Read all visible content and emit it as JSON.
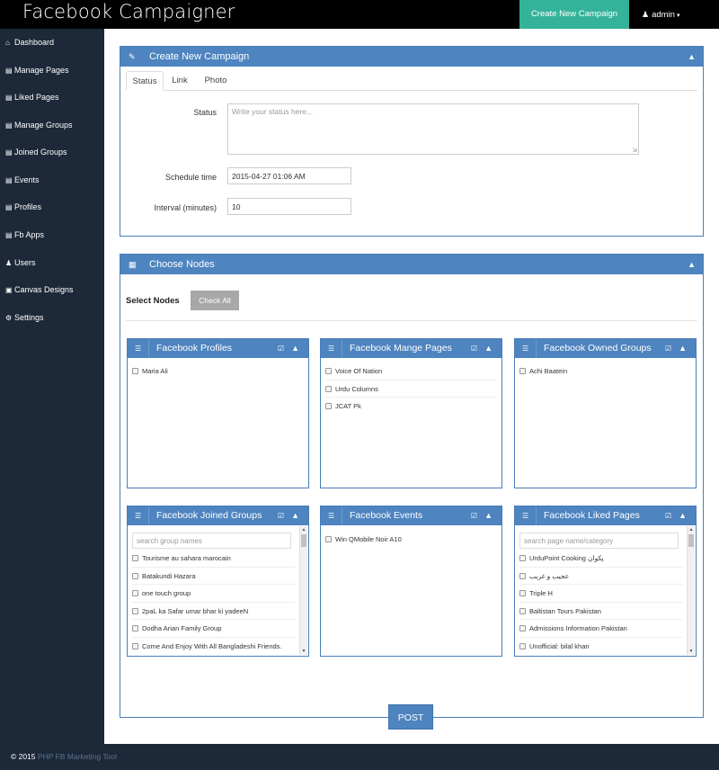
{
  "header": {
    "brand": "Facebook Campaigner",
    "create_button": "Create New Campaign",
    "user_icon": "user-icon",
    "user_label": "admin",
    "caret": "▾"
  },
  "sidebar": {
    "items": [
      {
        "icon": "⌂",
        "icon_name": "home-icon",
        "label": "Dashboard"
      },
      {
        "icon": "▤",
        "icon_name": "list-icon",
        "label": "Manage Pages"
      },
      {
        "icon": "▤",
        "icon_name": "list-icon",
        "label": "Liked Pages"
      },
      {
        "icon": "▤",
        "icon_name": "list-icon",
        "label": "Manage Groups"
      },
      {
        "icon": "▤",
        "icon_name": "list-icon",
        "label": "Joined Groups"
      },
      {
        "icon": "▤",
        "icon_name": "list-icon",
        "label": "Events"
      },
      {
        "icon": "▤",
        "icon_name": "list-icon",
        "label": "Profiles"
      },
      {
        "icon": "▤",
        "icon_name": "list-icon",
        "label": "Fb Apps"
      },
      {
        "icon": "👤",
        "icon_name": "user-icon",
        "label": "Users"
      },
      {
        "icon": "▣",
        "icon_name": "picture-icon",
        "label": "Canvas Designs"
      },
      {
        "icon": "⚙",
        "icon_name": "gear-icon",
        "label": "Settings"
      }
    ]
  },
  "campaign": {
    "title": "Create New Campaign",
    "tabs": [
      "Status",
      "Link",
      "Photo"
    ],
    "active_tab": "Status",
    "status_label": "Status",
    "status_placeholder": "Write your status here...",
    "schedule_label": "Schedule time",
    "schedule_value": "2015-04-27 01:06 AM",
    "interval_label": "Interval (minutes)",
    "interval_value": "10"
  },
  "nodes": {
    "title": "Choose Nodes",
    "select_label": "Select Nodes",
    "check_all": "Check All",
    "panels": {
      "profiles": {
        "title": "Facebook Profiles",
        "items": [
          "Maria Ali"
        ]
      },
      "pages": {
        "title": "Facebook Mange Pages",
        "items": [
          "Voice Of Nation",
          "Urdu Columns",
          "JCAT Pk"
        ]
      },
      "owned_groups": {
        "title": "Facebook Owned Groups",
        "items": [
          "Achi Baatein"
        ]
      },
      "joined_groups": {
        "title": "Facebook Joined Groups",
        "search_placeholder": "search group names",
        "items": [
          "Tourisme au sahara marocain",
          "Batakundi Hazara",
          "one touch group",
          "2paL ka Safar umar bhar ki yadeeN",
          "Dodha Arian Family Group",
          "Come And Enjoy With All Bangladeshi Friends."
        ]
      },
      "events": {
        "title": "Facebook Events",
        "items": [
          "Win QMobile Noir A10"
        ]
      },
      "liked_pages": {
        "title": "Facebook Liked Pages",
        "search_placeholder": "search page name/category",
        "items": [
          "UrduPoint Cooking پکوان",
          "عجیب و غریب",
          "Triple H",
          "Baltistan Tours Pakistan",
          "Admissions Information Pakistan",
          "Unofficial: bilal khan"
        ]
      }
    }
  },
  "post_button": "POST",
  "footer": {
    "copyright": "© 2015",
    "link": "PHP FB Marketing Tool"
  },
  "colors": {
    "panel_header": "#4e84bf",
    "create_button": "#34b39a",
    "sidebar": "#1d2939",
    "topbar": "#000000"
  }
}
